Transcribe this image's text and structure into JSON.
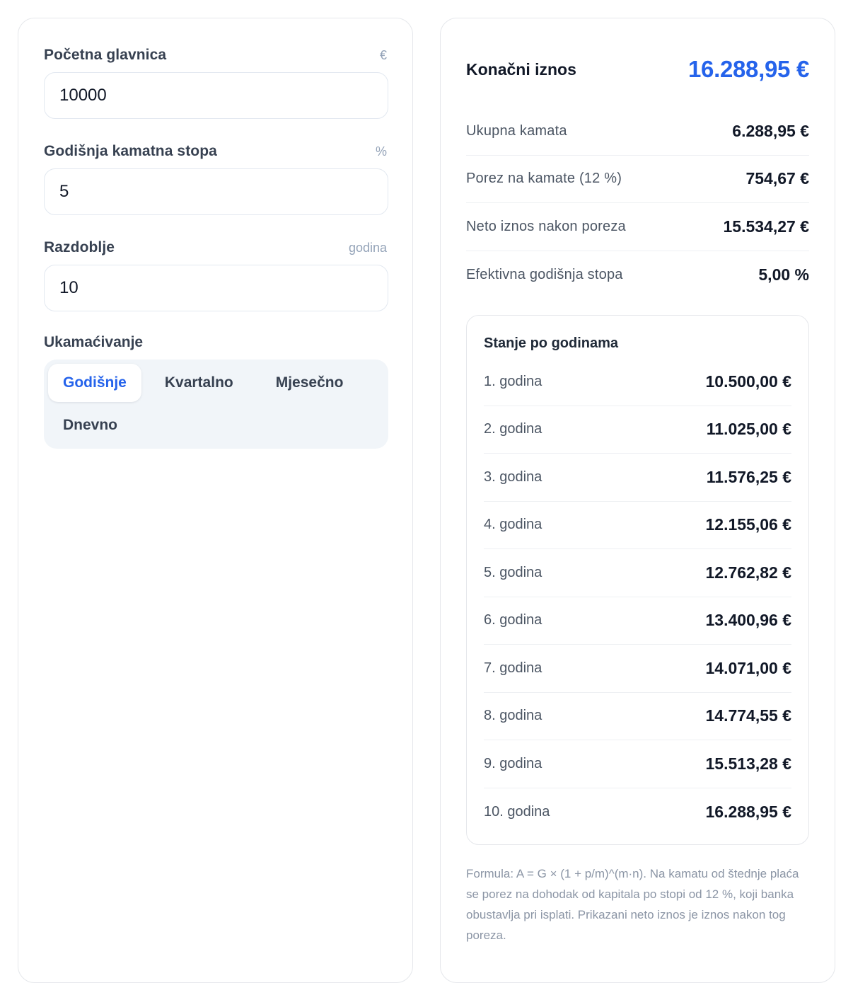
{
  "inputs": {
    "principal": {
      "label": "Početna glavnica",
      "unit": "€",
      "value": "10000"
    },
    "rate": {
      "label": "Godišnja kamatna stopa",
      "unit": "%",
      "value": "5"
    },
    "period": {
      "label": "Razdoblje",
      "unit": "godina",
      "value": "10"
    }
  },
  "compounding": {
    "label": "Ukamaćivanje",
    "options": [
      "Godišnje",
      "Kvartalno",
      "Mjesečno",
      "Dnevno"
    ],
    "selected": "Godišnje"
  },
  "results": {
    "final_label": "Konačni iznos",
    "final_value": "16.288,95 €",
    "stats": [
      {
        "label": "Ukupna kamata",
        "value": "6.288,95 €"
      },
      {
        "label": "Porez na kamate (12 %)",
        "value": "754,67 €"
      },
      {
        "label": "Neto iznos nakon poreza",
        "value": "15.534,27 €"
      },
      {
        "label": "Efektivna godišnja stopa",
        "value": "5,00 %"
      }
    ]
  },
  "yearly": {
    "title": "Stanje po godinama",
    "rows": [
      {
        "label": "1. godina",
        "value": "10.500,00 €"
      },
      {
        "label": "2. godina",
        "value": "11.025,00 €"
      },
      {
        "label": "3. godina",
        "value": "11.576,25 €"
      },
      {
        "label": "4. godina",
        "value": "12.155,06 €"
      },
      {
        "label": "5. godina",
        "value": "12.762,82 €"
      },
      {
        "label": "6. godina",
        "value": "13.400,96 €"
      },
      {
        "label": "7. godina",
        "value": "14.071,00 €"
      },
      {
        "label": "8. godina",
        "value": "14.774,55 €"
      },
      {
        "label": "9. godina",
        "value": "15.513,28 €"
      },
      {
        "label": "10. godina",
        "value": "16.288,95 €"
      }
    ]
  },
  "formula_note": "Formula: A = G × (1 + p/m)^(m·n). Na kamatu od štednje plaća se porez na dohodak od kapitala po stopi od 12 %, koji banka obustavlja pri isplati. Prikazani neto iznos je iznos nakon tog poreza.",
  "colors": {
    "accent": "#2563eb",
    "segment_bg": "#f1f5f9",
    "border": "#e5e7eb"
  }
}
